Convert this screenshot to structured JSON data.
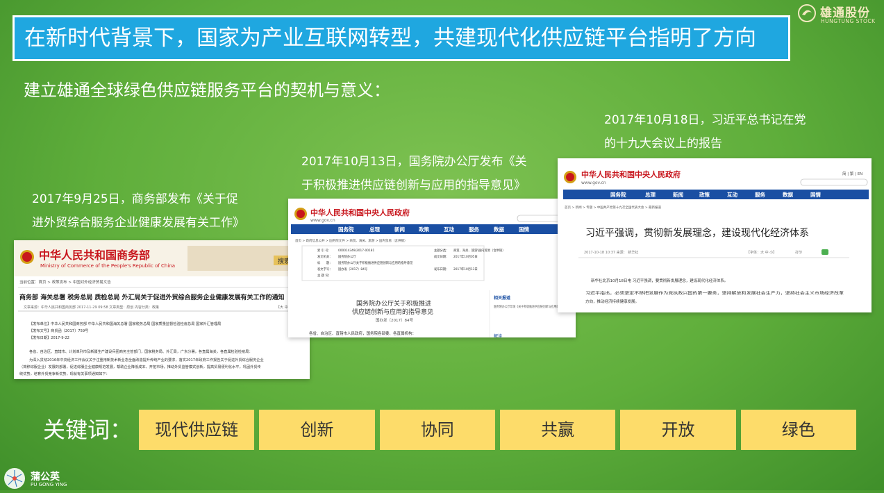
{
  "title": "在新时代背景下，国家为产业互联网转型，共建现代化供应链平台指明了方向",
  "brand_top": {
    "name": "雄通股份",
    "sub": "HUNGTUNG STOCK"
  },
  "subtitle": "建立雄通全球绿色供应链服务平台的契机与意义：",
  "captions": {
    "c1": [
      "2017年9月25日，商务部发布《关于促",
      "进外贸综合服务企业健康发展有关工作》"
    ],
    "c2": [
      "2017年10月13日，国务院办公厅发布《关",
      "于积极推进供应链创新与应用的指导意见》"
    ],
    "c3": [
      "2017年10月18日，习近平总书记在党",
      "的十九大会议上的报告"
    ]
  },
  "shot1": {
    "site": "中华人民共和国商务部",
    "site_en": "Ministry of Commerce of the People's Republic of China",
    "search": "搜索",
    "breadcrumb": "当前位置：首页 > 政策发布 > 中国对外经济贸易文告",
    "headline": "商务部 海关总署 税务总局 质检总局 外汇局关于促进外贸综合服务企业健康发展有关工作的通知",
    "meta": "文章来源：中华人民共和国商务部    2017-11-29 09:58    文章类型：原创    内容分类：政策",
    "font_ctrl": "【大 中 小】",
    "lines": [
      "【发布单位】中华人民共和国商务部 中华人民共和国海关总署 国家税务总局 国家质量监督检验检疫总局 国家外汇管理局",
      "【发布文号】商贸函〔2017〕759号",
      "【发布日期】2017-9-22",
      "各省、自治区、直辖市、计划单列市及新疆生产建设兵团商务主管部门，国家税务局、外汇局，广东分署，各直属海关，各直属检验检疫局：",
      "为深入贯彻2016年中央经济工作会议关于注重用新技术新业态全面改造提升传统产业的要求，落实2017年政府工作报告关于促进外贸综合服务企业",
      "（简称综服企业）发展的部署，促进综服企业健康规范发展，帮助企业降低成本、开拓市场，推动外贸监管模式创新，提高贸易便利化水平，巩固外贸传",
      "统优势，培育外贸竞争新优势，现就有关事项通知如下："
    ]
  },
  "shot2": {
    "site": "中华人民共和国中央人民政府",
    "url": "www.gov.cn",
    "nav": [
      "国务院",
      "总理",
      "新闻",
      "政策",
      "互动",
      "服务",
      "数据",
      "国情"
    ],
    "breadcrumb": "首页 > 政府信息公开 > 国务院文件 > 商贸、海关、旅游 > 国内贸易（含供销）",
    "info": [
      [
        "索 引 号：",
        "000014349/2017-00181",
        "主题分类：",
        "商贸、海关、旅游\\国内贸易（含供销）"
      ],
      [
        "发文机关：",
        "国务院办公厅",
        "成文日期：",
        "2017年10月05日"
      ],
      [
        "标　　题：",
        "国务院办公厅关于积极推进供应链创新与应用的指导意见",
        "",
        ""
      ],
      [
        "发文字号：",
        "国办发〔2017〕84号",
        "发布日期：",
        "2017年10月13日"
      ],
      [
        "主 题 词：",
        "",
        "",
        ""
      ]
    ],
    "doc_title_1": "国务院办公厅关于积极推进",
    "doc_title_2": "供应链创新与应用的指导意见",
    "doc_no": "国办发〔2017〕84号",
    "greeting": "各省、自治区、直辖市人民政府，国务院各部委、各直属机构：",
    "related_title": "相关报道",
    "related": [
      "国务院办公厅印发《关于积极推进供应链创新与应用的指导意见》"
    ],
    "explain": "解读"
  },
  "shot3": {
    "site": "中华人民共和国中央人民政府",
    "url": "www.gov.cn",
    "top_links": "简 | 繁 | EN",
    "nav": [
      "国务院",
      "总理",
      "新闻",
      "政策",
      "互动",
      "服务",
      "数据",
      "国情"
    ],
    "breadcrumb": "首页 > 新闻 > 专题 > 中国共产党第十九次全国代表大会 > 最新报道",
    "headline": "习近平强调，贯彻新发展理念，建设现代化经济体系",
    "meta": "2017-10-18 10:37    来源：  新华社",
    "font_ctrl": "【字体：大 中 小】",
    "print": "打印",
    "para1": "新华社北京10月18日电  习近平强调，要贯彻新发展理念，建设现代化经济体系。",
    "para2a": "习近平指出，必须坚定不移把发展作为党执政兴国的第一要务，坚持解放和发展社会生产力，坚持社会主义市场经济改革",
    "para2b": "方向，推动经济持续健康发展。"
  },
  "keywords_label": "关键词：",
  "keywords": [
    "现代供应链",
    "创新",
    "协同",
    "共赢",
    "开放",
    "绿色"
  ],
  "brand_bottom": {
    "name": "蒲公英",
    "sub": "PU GONG YING"
  },
  "colors": {
    "title_bg": "#1fa7e0",
    "keyword_bg": "#fddc6a",
    "gov_blue": "#1a4fa3",
    "gov_red": "#c8161d"
  }
}
